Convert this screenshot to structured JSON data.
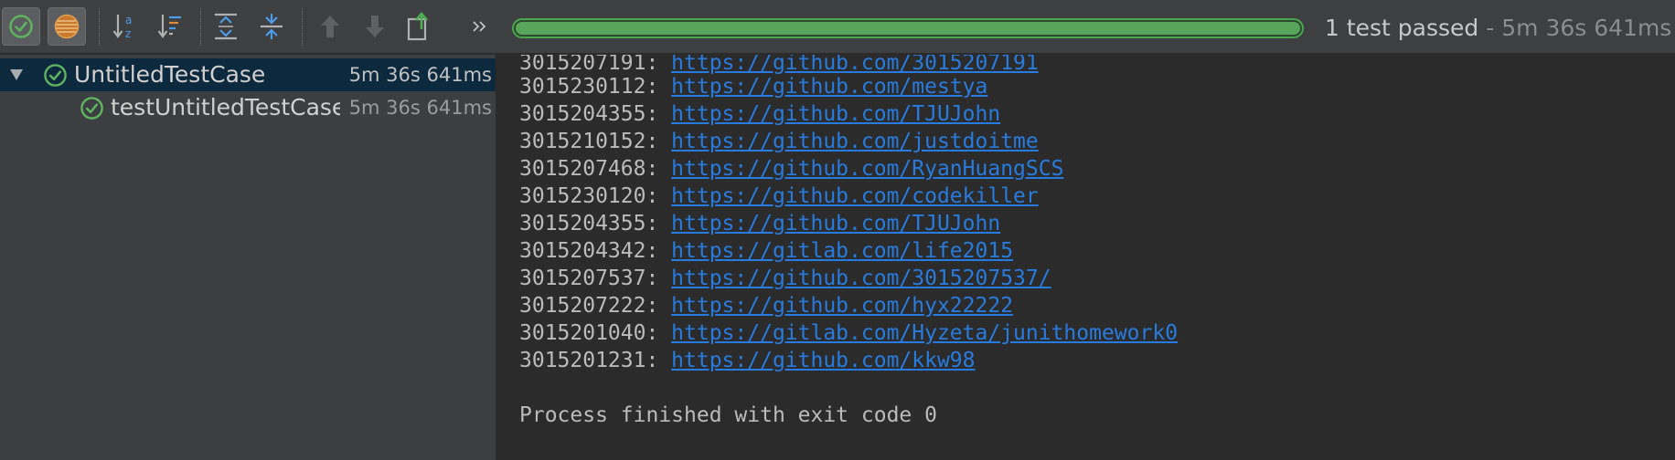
{
  "toolbar": {
    "buttons": [
      {
        "name": "show-passed-button",
        "icon": "passed-check-icon"
      },
      {
        "name": "show-ignored-button",
        "icon": "ignored-icon"
      },
      {
        "name": "sort-alphabetically-button",
        "icon": "sort-az-icon"
      },
      {
        "name": "sort-by-duration-button",
        "icon": "sort-duration-icon"
      },
      {
        "name": "expand-all-button",
        "icon": "expand-all-icon"
      },
      {
        "name": "collapse-all-button",
        "icon": "collapse-all-icon"
      },
      {
        "name": "previous-failed-button",
        "icon": "arrow-up-icon"
      },
      {
        "name": "next-failed-button",
        "icon": "arrow-down-icon"
      },
      {
        "name": "export-results-button",
        "icon": "export-icon"
      },
      {
        "name": "more-actions-button",
        "icon": "double-chevron-icon"
      }
    ],
    "progress": 1.0,
    "status_passed": "1 test passed",
    "status_sep": " - ",
    "status_time": "5m 36s 641ms"
  },
  "tree": {
    "items": [
      {
        "label": "UntitledTestCase",
        "duration": "5m 36s 641ms",
        "level": 0,
        "expanded": true
      },
      {
        "label": "testUntitledTestCase",
        "duration": "5m 36s 641ms",
        "level": 1
      }
    ]
  },
  "console": {
    "lines": [
      {
        "id": "3015207191: ",
        "url": "https://github.com/3015207191"
      },
      {
        "id": "3015230112: ",
        "url": "https://github.com/mestya"
      },
      {
        "id": "3015204355: ",
        "url": "https://github.com/TJUJohn"
      },
      {
        "id": "3015210152: ",
        "url": "https://github.com/justdoitme"
      },
      {
        "id": "3015207468: ",
        "url": "https://github.com/RyanHuangSCS"
      },
      {
        "id": "3015230120: ",
        "url": "https://github.com/codekiller"
      },
      {
        "id": "3015204355: ",
        "url": "https://github.com/TJUJohn"
      },
      {
        "id": "3015204342: ",
        "url": "https://gitlab.com/life2015"
      },
      {
        "id": "3015207537: ",
        "url": "https://github.com/3015207537/"
      },
      {
        "id": "3015207222: ",
        "url": "https://github.com/hyx22222"
      },
      {
        "id": "3015201040: ",
        "url": "https://gitlab.com/Hyzeta/junithomework0"
      },
      {
        "id": "3015201231: ",
        "url": "https://github.com/kkw98"
      }
    ],
    "finish": "Process finished with exit code 0"
  },
  "colors": {
    "pass_green": "#58a55c",
    "link_blue": "#287bde",
    "selection": "#0d293e"
  }
}
